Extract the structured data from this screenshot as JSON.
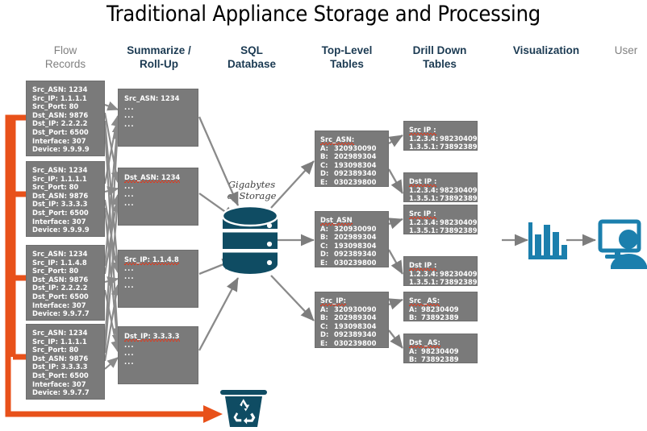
{
  "diagram": {
    "title": "Traditional Appliance Storage and Processing",
    "colors": {
      "header_blue": "#1b3a52",
      "header_gray": "#808080",
      "box_gray": "#7a7a7a",
      "db_teal": "#0f4c63",
      "accent_orange": "#e8511a",
      "icon_blue": "#1b7fad",
      "arrow_gray": "#808080"
    },
    "column_headers": [
      {
        "name": "flow-records",
        "line1": "Flow",
        "line2": "Records",
        "style": "gray"
      },
      {
        "name": "summarize-rollup",
        "line1": "Summarize /",
        "line2": "Roll-Up",
        "style": "blue"
      },
      {
        "name": "sql-database",
        "line1": "SQL",
        "line2": "Database",
        "style": "blue"
      },
      {
        "name": "top-level-tables",
        "line1": "Top-Level",
        "line2": "Tables",
        "style": "blue"
      },
      {
        "name": "drill-down-tables",
        "line1": "Drill Down",
        "line2": "Tables",
        "style": "blue"
      },
      {
        "name": "visualization",
        "line1": "Visualization",
        "line2": "",
        "style": "blue"
      },
      {
        "name": "user",
        "line1": "User",
        "line2": "",
        "style": "gray"
      }
    ],
    "flow_records": [
      {
        "fields": [
          "Src_ASN: 1234",
          "Src_IP: 1.1.1.1",
          "Src_Port: 80",
          "Dst_ASN: 9876",
          "Dst_IP: 2.2.2.2",
          "Dst_Port: 6500",
          "Interface: 307",
          "Device: 9.9.9.9"
        ]
      },
      {
        "fields": [
          "Src_ASN: 1234",
          "Src_IP: 1.1.1.1",
          "Src_Port: 80",
          "Dst_ASN: 9876",
          "Dst_IP: 3.3.3.3",
          "Dst_Port: 6500",
          "Interface: 307",
          "Device: 9.9.9.9"
        ]
      },
      {
        "fields": [
          "Src_ASN: 1234",
          "Src_IP: 1.1.4.8",
          "Src_Port: 80",
          "Dst_ASN: 9876",
          "Dst_IP: 2.2.2.2",
          "Dst_Port: 6500",
          "Interface: 307",
          "Device: 9.9.7.7"
        ]
      },
      {
        "fields": [
          "Src_ASN: 1234",
          "Src_IP: 1.1.1.1",
          "Src_Port: 80",
          "Dst_ASN: 9876",
          "Dst_IP: 3.3.3.3",
          "Dst_Port: 6500",
          "Interface: 307",
          "Device: 9.9.7.7"
        ]
      }
    ],
    "summaries": [
      {
        "heading": "Src_ASN: 1234",
        "misspelled": false,
        "dots": [
          "...",
          "...",
          "..."
        ]
      },
      {
        "heading": "Dst_ASN: 1234",
        "misspelled": true,
        "dots": [
          "...",
          "...",
          "..."
        ]
      },
      {
        "heading": "Src_IP: 1.1.4.8",
        "misspelled": true,
        "dots": [
          "...",
          "...",
          "..."
        ]
      },
      {
        "heading": "Dst_IP: 3.3.3.3",
        "misspelled": true,
        "dots": [
          "...",
          "...",
          "..."
        ]
      }
    ],
    "database": {
      "label_line1": "Gigabytes",
      "label_line2": "of Storage"
    },
    "top_level_tables": [
      {
        "heading": "Src_ASN:",
        "rows": [
          {
            "key": "A:",
            "value": "320930090"
          },
          {
            "key": "B:",
            "value": "202989304"
          },
          {
            "key": "C:",
            "value": "193098304"
          },
          {
            "key": "D:",
            "value": "092389340"
          },
          {
            "key": "E:",
            "value": "030239800"
          }
        ]
      },
      {
        "heading": "Dst_ASN",
        "rows": [
          {
            "key": "A:",
            "value": "320930090"
          },
          {
            "key": "B:",
            "value": "202989304"
          },
          {
            "key": "C:",
            "value": "193098304"
          },
          {
            "key": "D:",
            "value": "092389340"
          },
          {
            "key": "E:",
            "value": "030239800"
          }
        ]
      },
      {
        "heading": "Src_IP:",
        "rows": [
          {
            "key": "A:",
            "value": "320930090"
          },
          {
            "key": "B:",
            "value": "202989304"
          },
          {
            "key": "C:",
            "value": "193098304"
          },
          {
            "key": "D:",
            "value": "092389340"
          },
          {
            "key": "E:",
            "value": "030239800"
          }
        ]
      }
    ],
    "drill_down_tables": [
      {
        "heading": "Src IP :",
        "rows": [
          {
            "key": "1.2.3.4:",
            "value": "98230409"
          },
          {
            "key": "1.3.5.1:",
            "value": "73892389"
          }
        ]
      },
      {
        "heading": "Dst IP :",
        "rows": [
          {
            "key": "1.2.3.4:",
            "value": "98230409"
          },
          {
            "key": "1.3.5.1:",
            "value": "73892389"
          }
        ]
      },
      {
        "heading": "Src IP :",
        "rows": [
          {
            "key": "1.2.3.4:",
            "value": "98230409"
          },
          {
            "key": "1.3.5.1:",
            "value": "73892389"
          }
        ]
      },
      {
        "heading": "Dst IP :",
        "rows": [
          {
            "key": "1.2.3.4:",
            "value": "98230409"
          },
          {
            "key": "1.3.5.1:",
            "value": "73892389"
          }
        ]
      },
      {
        "heading": "Src _AS:",
        "rows": [
          {
            "key": "A:",
            "value": "98230409"
          },
          {
            "key": "B:",
            "value": "73892389"
          }
        ]
      },
      {
        "heading": "Dst _AS:",
        "rows": [
          {
            "key": "A:",
            "value": "98230409"
          },
          {
            "key": "B:",
            "value": "73892389"
          }
        ]
      }
    ],
    "icons": {
      "visualization": "bar-chart-icon",
      "user": "user-at-monitor-icon",
      "discard": "recycle-bin-icon",
      "storage": "database-cylinder-icon"
    }
  }
}
